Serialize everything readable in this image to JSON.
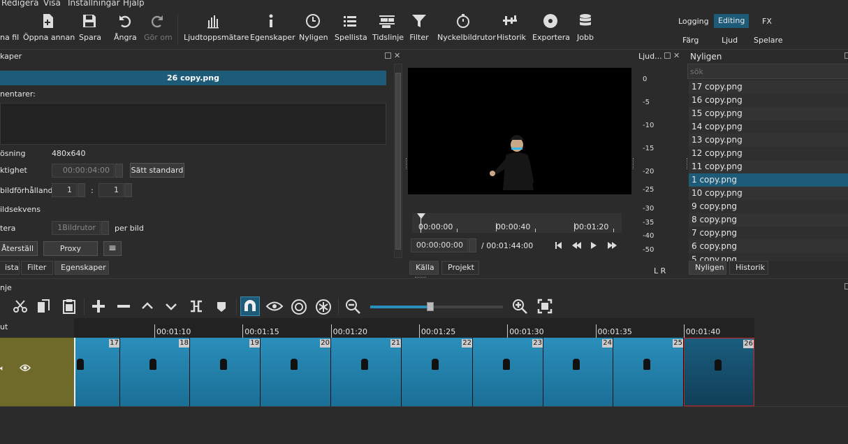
{
  "menu": [
    "Redigera",
    "Visa",
    "Inställningar",
    "Hjälp"
  ],
  "toolbar": {
    "open_file": "na fil",
    "open_other": "Öppna annan",
    "save": "Spara",
    "undo": "Ångra",
    "redo": "Gör om",
    "peak_meter": "Ljudtoppsmätare",
    "properties": "Egenskaper",
    "recent": "Nyligen",
    "playlist": "Spellista",
    "timeline": "Tidslinje",
    "filter": "Filter",
    "keyframes": "Nyckelbildrutor",
    "history": "Historik",
    "export": "Exportera",
    "jobs": "Jobb"
  },
  "workspaces": {
    "logging": "Logging",
    "editing": "Editing",
    "fx": "FX",
    "color": "Färg",
    "audio": "Ljud",
    "player": "Spelare"
  },
  "properties": {
    "title": "kaper",
    "filename": "26 copy.png",
    "comments_label": "nentarer:",
    "resolution_label": "ösning",
    "resolution_value": "480x640",
    "duration_label": "ktighet",
    "duration_value": "00:00:04:00",
    "set_default": "Sätt standard",
    "aspect_label": "bildförhållande",
    "aspect_w": "1",
    "aspect_sep": ":",
    "aspect_h": "1",
    "sequence_label": "ildsekvens",
    "repeat_label": "tera",
    "repeat_value": "1Bildrutor",
    "per_image": "per bild",
    "reset": "Återställ",
    "proxy": "Proxy",
    "menu_glyph": "≡"
  },
  "left_tabs": [
    "ista",
    "Filter",
    "Egenskaper"
  ],
  "player": {
    "time_0": "00:00:00",
    "time_40": "00:00:40",
    "time_80": "00:01:20",
    "position": "00:00:00:00",
    "duration": "/ 00:01:44:00",
    "tabs": [
      "Källa",
      "Projekt"
    ]
  },
  "audio_meter": {
    "title": "Ljud...",
    "scale": [
      "0",
      "-5",
      "-10",
      "-15",
      "-20",
      "-25",
      "-30",
      "-35",
      "-40",
      "-50"
    ],
    "lr": "L  R"
  },
  "recent": {
    "title": "Nyligen",
    "search_placeholder": "sök",
    "items": [
      "17 copy.png",
      "16 copy.png",
      "15 copy.png",
      "14 copy.png",
      "13 copy.png",
      "12 copy.png",
      "11 copy.png",
      "1 copy.png",
      "10 copy.png",
      "9 copy.png",
      "8 copy.png",
      "7 copy.png",
      "6 copy.png",
      "5 copy.png"
    ],
    "selected_index": 7,
    "tabs": [
      "Nyligen",
      "Historik"
    ]
  },
  "timeline": {
    "title": "nje",
    "track_label": "ut",
    "ruler": [
      "00:01:10",
      "00:01:15",
      "00:01:20",
      "00:01:25",
      "00:01:30",
      "00:01:35",
      "00:01:40"
    ],
    "clip_numbers": [
      "17",
      "18",
      "19",
      "20",
      "21",
      "22",
      "23",
      "24",
      "25",
      "26"
    ],
    "zoom_level": 0.45
  },
  "colors": {
    "accent": "#1e5b78",
    "clip": "#2a8fbb",
    "track_head": "#6f6a2a",
    "selection_border": "#d02020"
  }
}
